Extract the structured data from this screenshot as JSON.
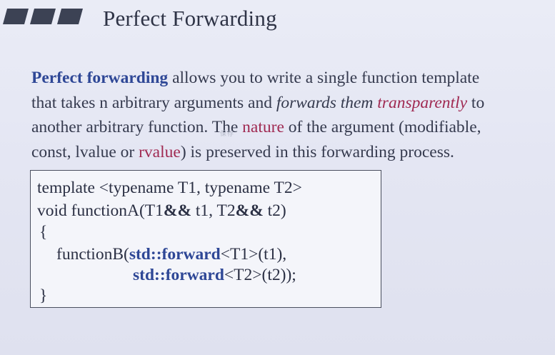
{
  "slide": {
    "title": "Perfect Forwarding",
    "paragraph": {
      "l1_bold": "Perfect forwarding",
      "l1_rest": " allows you to write a single function template",
      "l2_pre": "that takes n arbitrary arguments and ",
      "l2_italic": "forwards them ",
      "l2_italic_colored": "transparently",
      "l2_post": " to",
      "l3_pre": "another arbitrary function. The ",
      "l3_colored": "nature",
      "l3_post": " of the argument (modifiable,",
      "l4_pre": "const, lvalue or ",
      "l4_colored": "rvalue",
      "l4_post": ") is preserved in this forwarding process."
    },
    "overlay_mark": "保存",
    "code": {
      "line1": "template <typename T1, typename T2>",
      "line2_a": "void functionA(T1",
      "line2_op1": "&&",
      "line2_b": " t1, T2",
      "line2_op2": "&&",
      "line2_c": " t2)",
      "line3": "{",
      "line4_a": "functionB(",
      "line4_kw": "std::forward",
      "line4_b": "<T1>(t1),",
      "line5_kw": "std::forward",
      "line5_b": "<T2>(t2));",
      "line6": "}"
    },
    "colors": {
      "accent_blue": "#2e4796",
      "accent_magenta": "#a02a52",
      "text": "#353a4e"
    }
  }
}
